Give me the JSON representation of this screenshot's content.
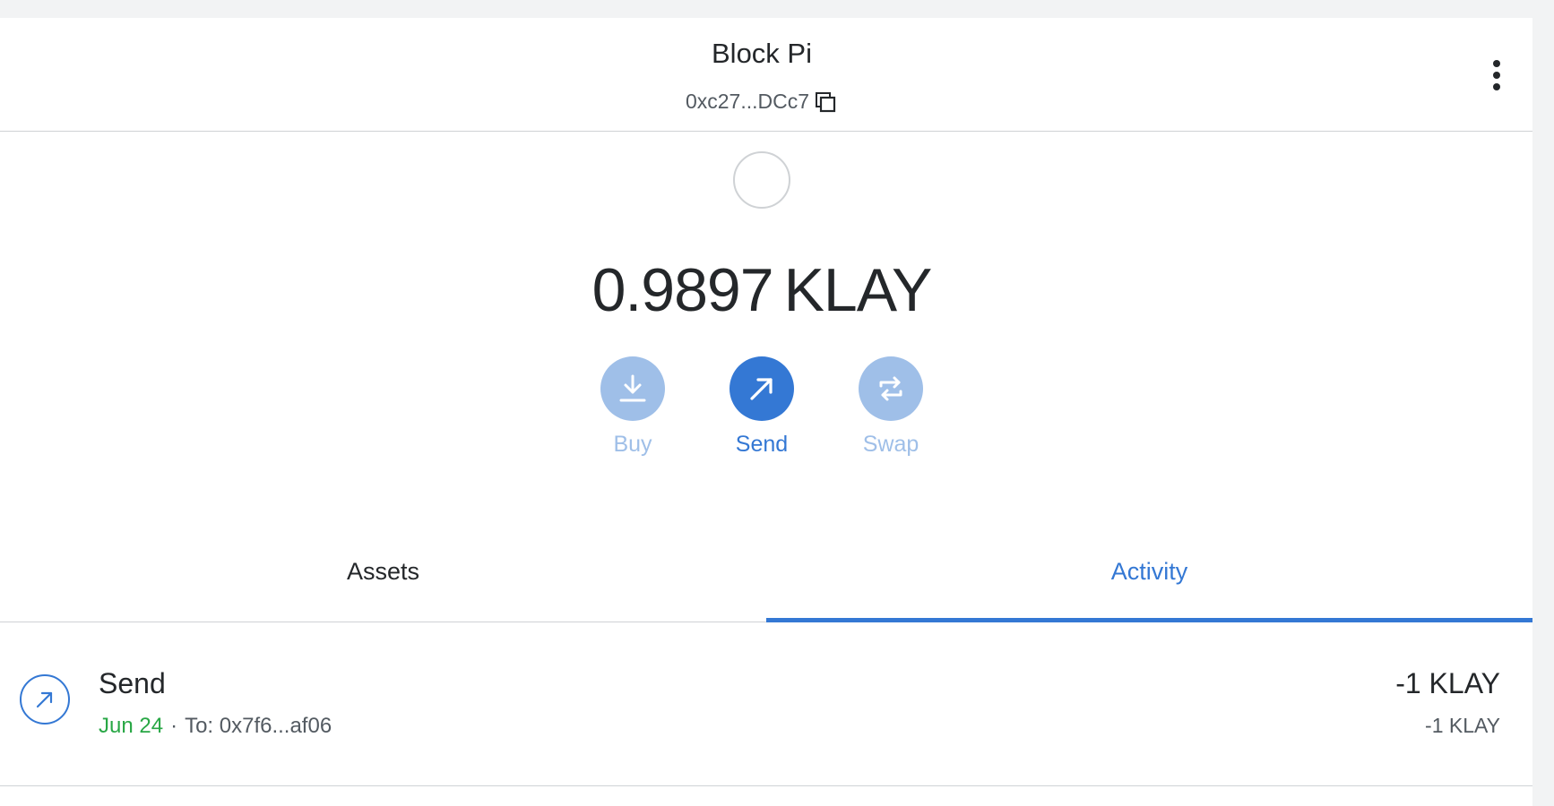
{
  "header": {
    "account_name": "Block Pi",
    "address": "0xc27...DCc7"
  },
  "balance": {
    "amount": "0.9897",
    "unit": "KLAY"
  },
  "actions": [
    {
      "label": "Buy",
      "icon": "download-icon",
      "state": "disabled"
    },
    {
      "label": "Send",
      "icon": "arrow-up-right-icon",
      "state": "enabled"
    },
    {
      "label": "Swap",
      "icon": "swap-arrows-icon",
      "state": "disabled"
    }
  ],
  "tabs": [
    {
      "label": "Assets",
      "active": false
    },
    {
      "label": "Activity",
      "active": true
    }
  ],
  "activity": [
    {
      "title": "Send",
      "date": "Jun 24",
      "separator": "·",
      "to": "To: 0x7f6...af06",
      "amount": "-1 KLAY",
      "amount_secondary": "-1 KLAY",
      "icon": "arrow-up-right-icon"
    }
  ],
  "colors": {
    "accent": "#3478d4",
    "accent_disabled": "#9fbfe8",
    "success": "#28a745",
    "text": "#24272a",
    "muted": "#535a61",
    "border": "#cfd2d5"
  }
}
